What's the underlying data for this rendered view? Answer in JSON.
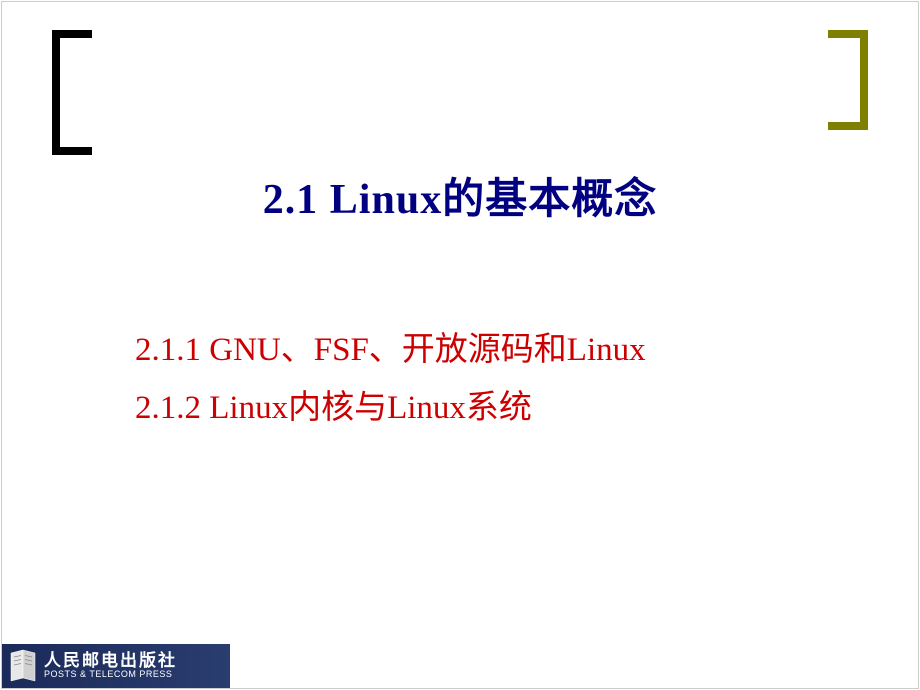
{
  "slide": {
    "title": "2.1  Linux的基本概念",
    "items": [
      "2.1.1  GNU、FSF、开放源码和Linux",
      "2.1.2  Linux内核与Linux系统"
    ]
  },
  "footer": {
    "publisher_cn": "人民邮电出版社",
    "publisher_en": "POSTS & TELECOM PRESS"
  }
}
